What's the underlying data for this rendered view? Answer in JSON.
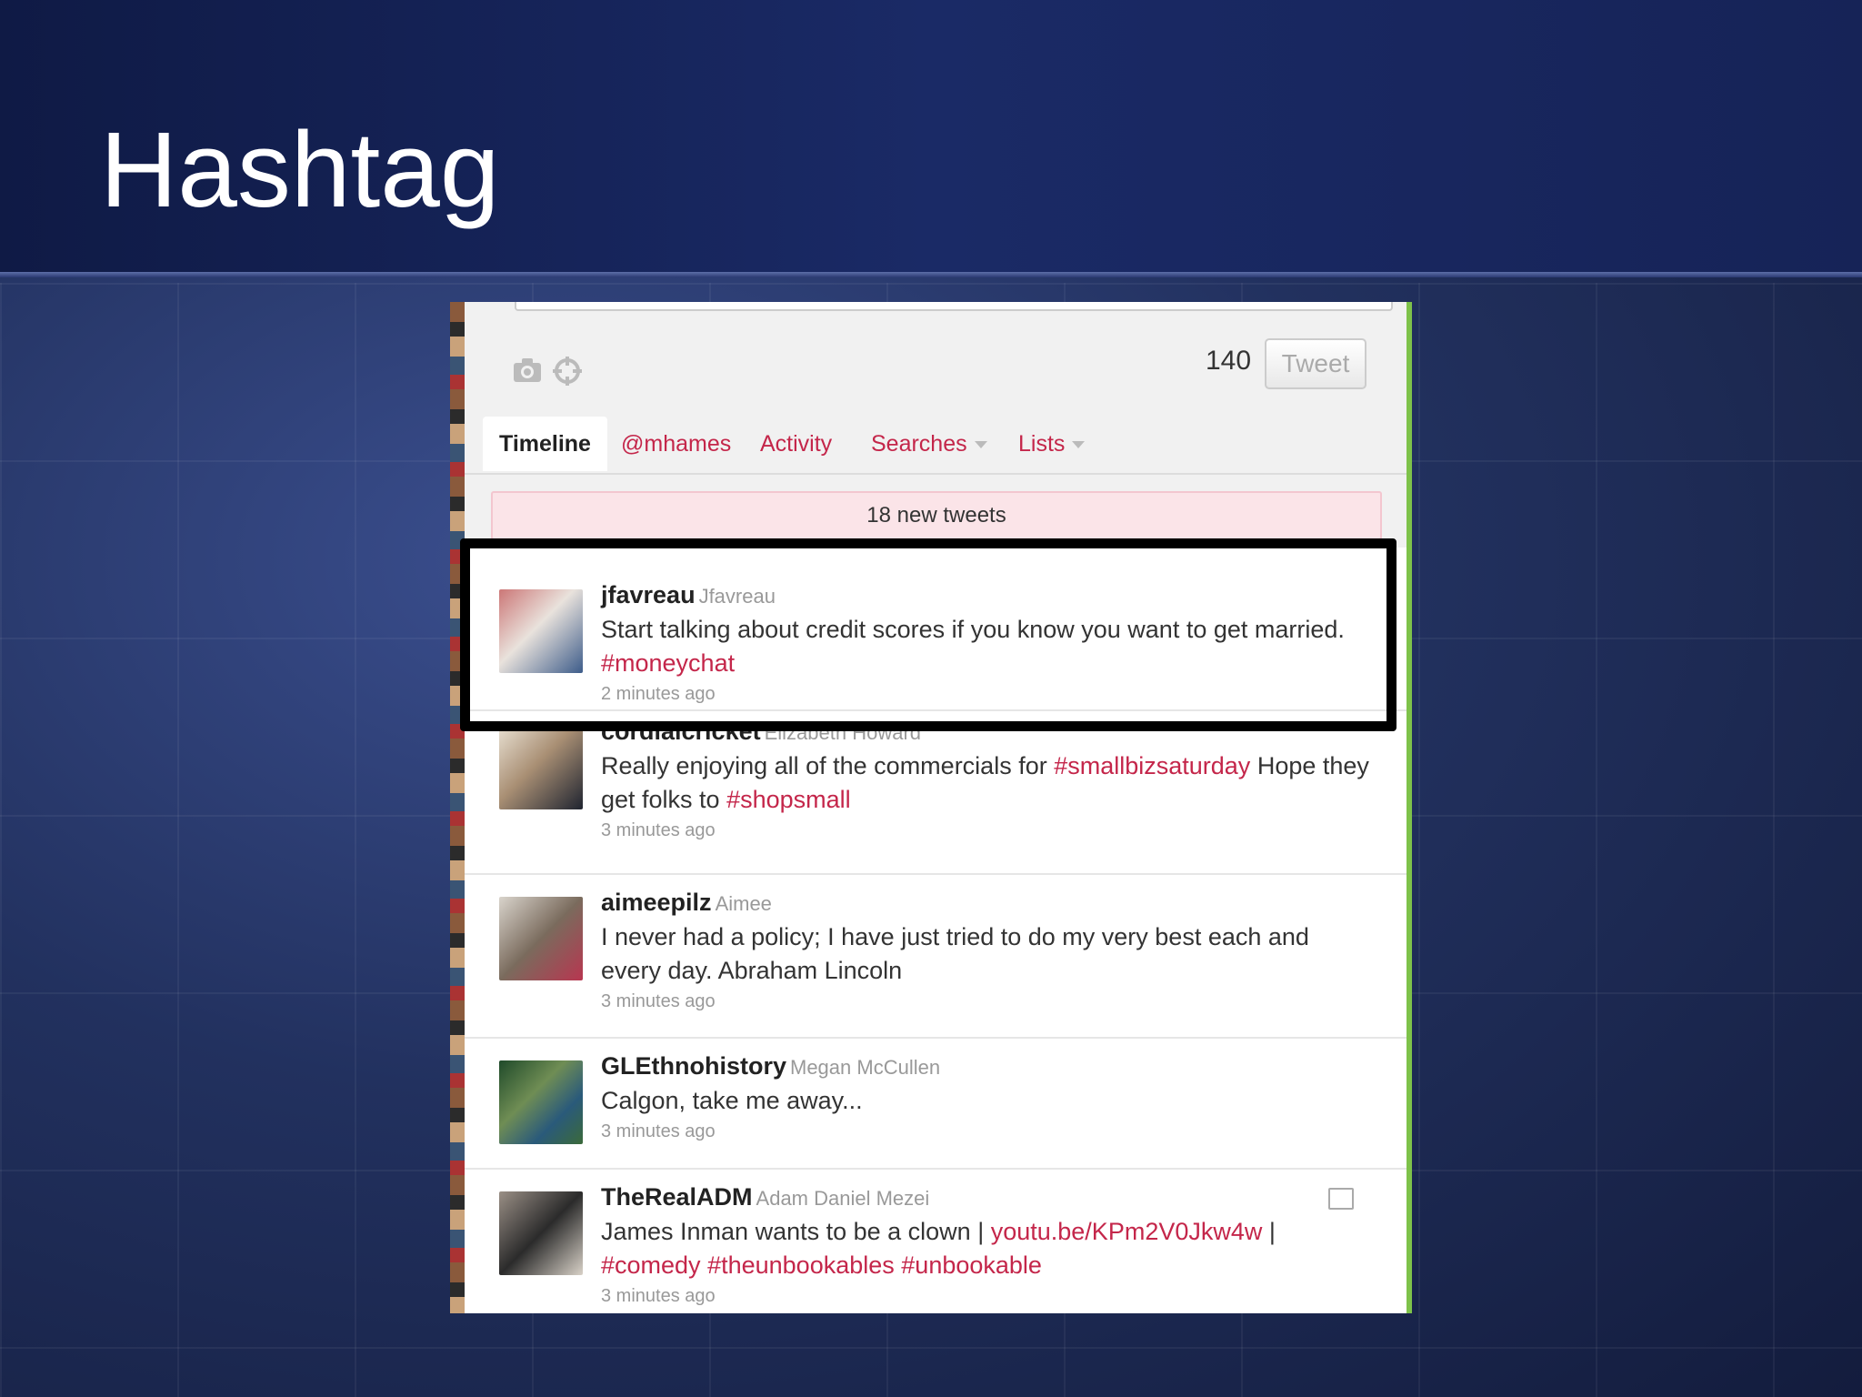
{
  "slide": {
    "title": "Hashtag"
  },
  "composer": {
    "camera_icon": "camera-icon",
    "location_icon": "location-icon",
    "char_count": "140",
    "tweet_button": "Tweet"
  },
  "tabs": [
    {
      "label": "Timeline",
      "active": true
    },
    {
      "label": "@mhames"
    },
    {
      "label": "Activity"
    },
    {
      "label": "Searches",
      "dropdown": true
    },
    {
      "label": "Lists",
      "dropdown": true
    }
  ],
  "new_tweets_banner": "18 new tweets",
  "tweets": [
    {
      "screen_name": "jfavreau",
      "real_name": "Jfavreau",
      "text_before": "Start talking about credit scores if you know you want to get married. ",
      "hashtag1": "#moneychat",
      "time": "2 minutes ago"
    },
    {
      "screen_name": "cordialcricket",
      "real_name": "Elizabeth Howard",
      "text_before": "Really enjoying all of the commercials for ",
      "hashtag1": "#smallbizsaturday",
      "text_middle": " Hope they get folks to ",
      "hashtag2": "#shopsmall",
      "time": "3 minutes ago"
    },
    {
      "screen_name": "aimeepilz",
      "real_name": "Aimee",
      "text_before": "I never had a policy; I have just tried to do my very best each and every day. Abraham Lincoln",
      "time": "3 minutes ago"
    },
    {
      "screen_name": "GLEthnohistory",
      "real_name": "Megan McCullen",
      "text_before": "Calgon, take me away...",
      "time": "3 minutes ago"
    },
    {
      "screen_name": "TheRealADM",
      "real_name": "Adam Daniel Mezei",
      "text_before": "James Inman wants to be a clown | ",
      "link": "youtu.be/KPm2V0Jkw4w",
      "text_middle": " | ",
      "hashtag1": "#comedy",
      "hashtag2": "#theunbookables",
      "hashtag3": "#unbookable",
      "time": "3 minutes ago"
    }
  ],
  "colors": {
    "link": "#c4264a",
    "highlight_border": "#000000",
    "banner_bg": "#fbe4e8"
  }
}
